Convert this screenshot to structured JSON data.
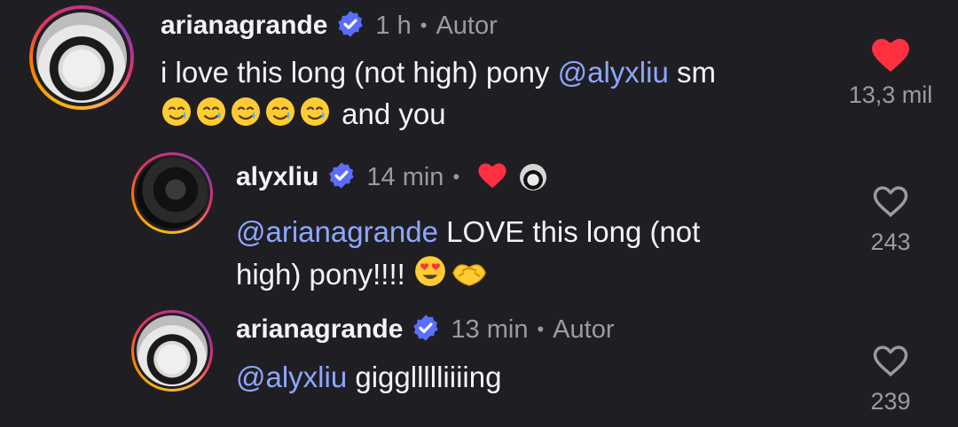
{
  "comments": [
    {
      "username": "arianagrande",
      "time": "1 h",
      "tag": "Autor",
      "text_line1_before": "i love this long (not high) pony ",
      "mention": "@alyxliu",
      "text_line1_after": " sm",
      "text_line2": " and you",
      "emojis": [
        "smiling-face-with-tear",
        "smiling-face-with-tear",
        "smiling-face-with-tear",
        "smiling-face-with-tear",
        "smiling-face-with-tear"
      ],
      "likes": "13,3 mil",
      "liked": true
    },
    {
      "username": "alyxliu",
      "time": "14 min",
      "mention": "@arianagrande",
      "text_line1_after": " LOVE this long (not",
      "text_line2": "high) pony!!!! ",
      "emojis": [
        "heart-eyes",
        "heart-hands"
      ],
      "creator_liked": true,
      "likes": "243",
      "liked": false
    },
    {
      "username": "arianagrande",
      "time": "13 min",
      "tag": "Autor",
      "mention": "@alyxliu",
      "text_line1_after": " giggllllliiiing",
      "likes": "239",
      "liked": false
    }
  ],
  "colors": {
    "background": "#1f1f23",
    "mention": "#8ea7ff",
    "verified": "#5b6dff",
    "like_red": "#ff3040",
    "muted": "#9a9aa2"
  }
}
